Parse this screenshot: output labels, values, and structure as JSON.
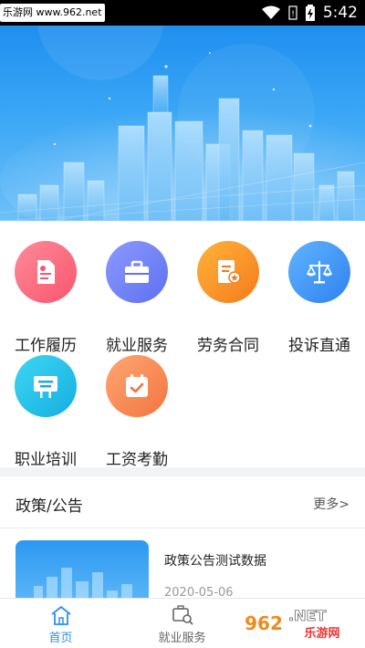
{
  "status_bar": {
    "watermark": "乐游网 www.962.net",
    "time": "5:42"
  },
  "grid": {
    "items": [
      {
        "label": "工作履历",
        "icon": "resume-icon",
        "color_from": "#ff8a9a",
        "color_to": "#f7566d"
      },
      {
        "label": "就业服务",
        "icon": "briefcase-icon",
        "color_from": "#8a9bff",
        "color_to": "#5f6ff0"
      },
      {
        "label": "劳务合同",
        "icon": "contract-icon",
        "color_from": "#ffb43a",
        "color_to": "#f57a1c"
      },
      {
        "label": "投诉直通",
        "icon": "scales-icon",
        "color_from": "#5fb4ff",
        "color_to": "#2f82ee"
      },
      {
        "label": "职业培训",
        "icon": "training-board-icon",
        "color_from": "#3ed6f2",
        "color_to": "#15aee0"
      },
      {
        "label": "工资考勤",
        "icon": "calendar-check-icon",
        "color_from": "#ffa773",
        "color_to": "#f2743f"
      }
    ]
  },
  "news": {
    "section_title": "政策/公告",
    "more_label": "更多>",
    "item": {
      "title": "政策公告测试数据",
      "date": "2020-05-06"
    }
  },
  "tabbar": {
    "tabs": [
      {
        "label": "首页",
        "icon": "home-icon",
        "active": true
      },
      {
        "label": "就业服务",
        "icon": "job-search-icon",
        "active": false
      },
      {
        "label": "",
        "icon": "hidden-icon",
        "active": false
      }
    ]
  },
  "colors": {
    "accent": "#2b8ff0",
    "banner": "#2b95f2"
  },
  "corner_watermark": "962.NET 乐游网"
}
